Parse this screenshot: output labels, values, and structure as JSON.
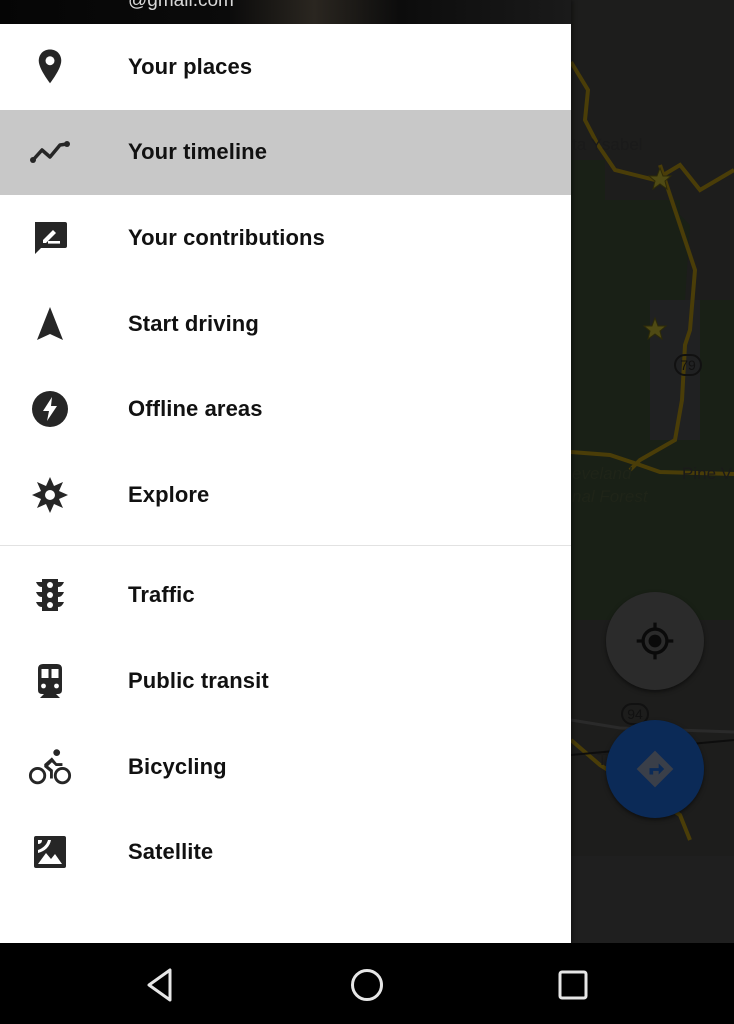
{
  "header": {
    "account_email": "@gmail.com"
  },
  "menu": {
    "group1": [
      {
        "label": "Your places",
        "icon": "place-pin-icon",
        "active": false
      },
      {
        "label": "Your timeline",
        "icon": "timeline-icon",
        "active": true
      },
      {
        "label": "Your contributions",
        "icon": "contributions-icon",
        "active": false
      },
      {
        "label": "Start driving",
        "icon": "navigation-arrow-icon",
        "active": false
      },
      {
        "label": "Offline areas",
        "icon": "offline-bolt-icon",
        "active": false
      },
      {
        "label": "Explore",
        "icon": "explore-compass-icon",
        "active": false
      }
    ],
    "group2": [
      {
        "label": "Traffic",
        "icon": "traffic-light-icon"
      },
      {
        "label": "Public transit",
        "icon": "train-icon"
      },
      {
        "label": "Bicycling",
        "icon": "bicycle-icon"
      },
      {
        "label": "Satellite",
        "icon": "satellite-image-icon"
      }
    ]
  },
  "map": {
    "labels": {
      "town_1": "ta Ysabel",
      "forest_line1": "eveland",
      "forest_line2": "nal Forest",
      "town_2": "Pine V",
      "town_3": "T"
    },
    "route_shields": [
      "79",
      "94"
    ]
  },
  "colors": {
    "active_item_bg": "#c8c8c8",
    "drawer_bg": "#ffffff",
    "text": "#111111",
    "directions_fab": "#0b2a57"
  },
  "navbar": {
    "back": "back-icon",
    "home": "home-icon",
    "recents": "recents-icon"
  }
}
